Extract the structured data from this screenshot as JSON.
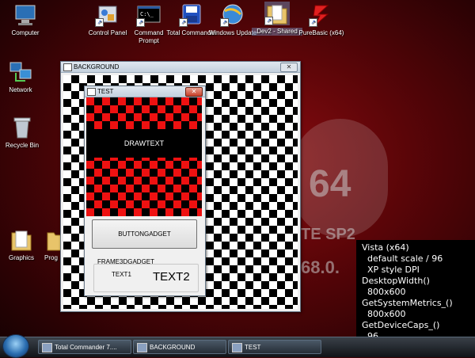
{
  "desktop": {
    "icons": [
      {
        "label": "Computer",
        "icon": "computer-icon"
      },
      {
        "label": "Network",
        "icon": "network-icon"
      },
      {
        "label": "Recycle Bin",
        "icon": "recycle-bin-icon"
      },
      {
        "label": "Graphics",
        "icon": "folder-icon"
      },
      {
        "label": "Prog",
        "icon": "folder-icon"
      },
      {
        "label": "Control Panel",
        "icon": "control-panel-icon"
      },
      {
        "label": "Command Prompt",
        "icon": "command-prompt-icon"
      },
      {
        "label": "Total Commander",
        "icon": "total-commander-icon"
      },
      {
        "label": "Windows Update",
        "icon": "windows-update-icon"
      },
      {
        "label": "Dev2 - Shared",
        "icon": "folder-icon"
      },
      {
        "label": "PureBasic (x64)",
        "icon": "purebasic-icon"
      }
    ],
    "wallpaper_text": [
      "64",
      "TE SP2",
      "68.0."
    ]
  },
  "background_window": {
    "title": "BACKGROUND",
    "close_label": "✕"
  },
  "test_window": {
    "title": "TEST",
    "close_label": "✕",
    "drawtext": "DRAWTEXT",
    "button_label": "BUTTONGADGET",
    "frame_label": "FRAME3DGADGET",
    "text1": "TEXT1",
    "text2": "TEXT2"
  },
  "info_panel": {
    "lines": [
      "Vista (x64)",
      "  default scale / 96",
      "  XP style DPI",
      "DesktopWidth()",
      "  800x600",
      "GetSystemMetrics_()",
      "  800x600",
      "GetDeviceCaps_()",
      "  96"
    ]
  },
  "taskbar": {
    "buttons": [
      {
        "label": "Total Commander 7...."
      },
      {
        "label": "BACKGROUND"
      },
      {
        "label": "TEST"
      }
    ]
  },
  "colors": {
    "checker_red": "#ee1111",
    "info_panel_bg": "#000000",
    "close_active": "#c8402a"
  }
}
